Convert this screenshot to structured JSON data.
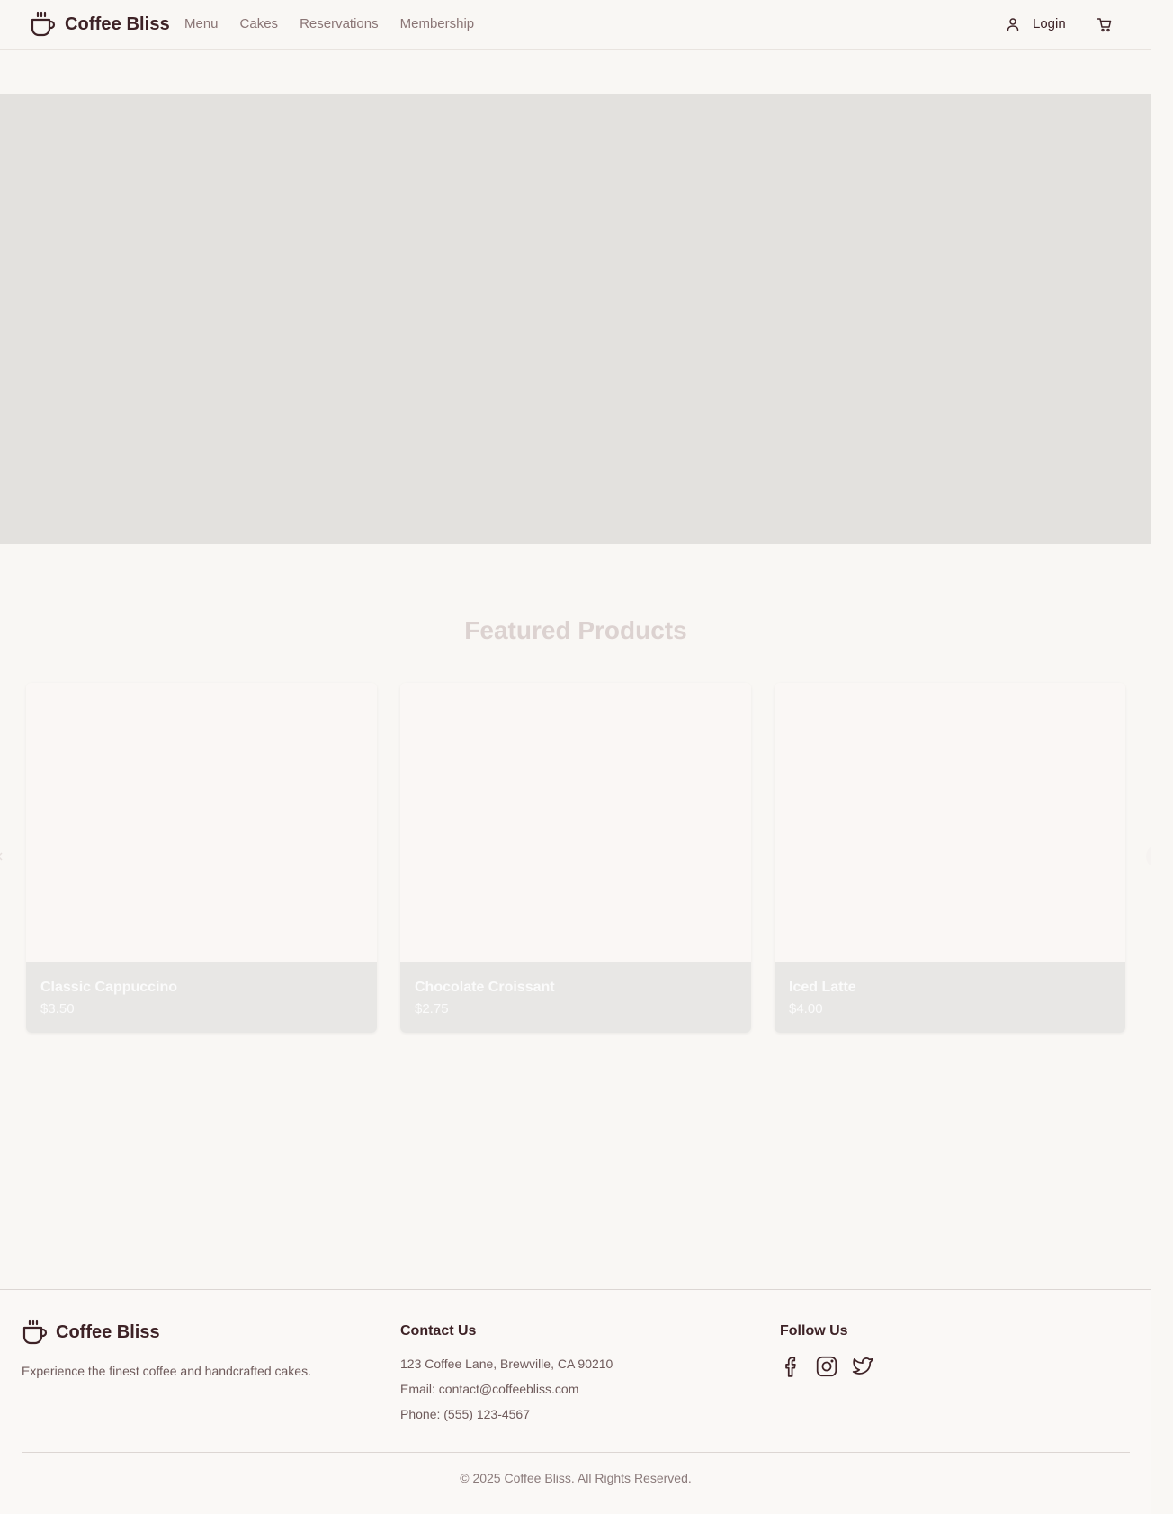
{
  "header": {
    "brand": "Coffee Bliss",
    "nav": [
      "Menu",
      "Cakes",
      "Reservations",
      "Membership"
    ],
    "login_label": "Login"
  },
  "featured": {
    "title": "Featured Products",
    "products": [
      {
        "name": "Classic Cappuccino",
        "price": "$3.50"
      },
      {
        "name": "Chocolate Croissant",
        "price": "$2.75"
      },
      {
        "name": "Iced Latte",
        "price": "$4.00"
      }
    ]
  },
  "footer": {
    "brand": "Coffee Bliss",
    "tagline": "Experience the finest coffee and handcrafted cakes.",
    "contact_title": "Contact Us",
    "contact_lines": [
      "123 Coffee Lane, Brewville, CA 90210",
      "Email: contact@coffeebliss.com",
      "Phone: (555) 123-4567"
    ],
    "follow_title": "Follow Us",
    "social_icons": [
      "facebook-icon",
      "instagram-icon",
      "twitter-icon"
    ],
    "copyright": "© 2025 Coffee Bliss. All Rights Reserved."
  },
  "colors": {
    "brand_text": "#3d2226",
    "nav_text": "#8a7575",
    "background": "#f9f7f4",
    "hero_placeholder": "#e3e1de"
  }
}
